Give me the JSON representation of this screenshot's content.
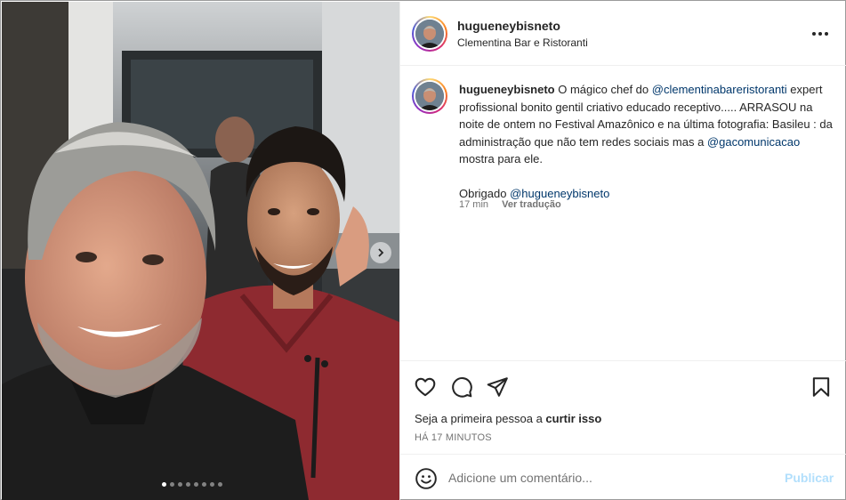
{
  "post": {
    "author": "hugueneybisneto",
    "location": "Clementina Bar e Ristoranti",
    "caption": {
      "username": "hugueneybisneto",
      "parts": [
        {
          "text": " O mágico chef do ",
          "type": "text"
        },
        {
          "text": "@clementinabareristoranti",
          "type": "mention"
        },
        {
          "text": " expert profissional bonito gentil criativo educado receptivo..... ARRASOU na noite de ontem no Festival Amazônico e na última fotografia: Basileu : da administração que não tem redes sociais mas a ",
          "type": "text"
        },
        {
          "text": "@gacomunicacao",
          "type": "mention"
        },
        {
          "text": " mostra para ele.",
          "type": "text"
        }
      ],
      "thanks_text": "Obrigado ",
      "thanks_mention": "@hugueneybisneto",
      "time": "17 min",
      "translate_label": "Ver tradução"
    },
    "likes": {
      "prefix": "Seja a primeira pessoa a ",
      "link": "curtir isso"
    },
    "time_ago": "HÁ 17 MINUTOS",
    "comment": {
      "placeholder": "Adicione um comentário...",
      "publish_label": "Publicar"
    },
    "carousel": {
      "total": 8,
      "active": 0
    }
  },
  "icons": {
    "more": "more-horizontal-icon",
    "like": "heart-icon",
    "comment": "comment-bubble-icon",
    "share": "paper-plane-icon",
    "save": "bookmark-icon",
    "emoji": "smiley-icon",
    "next": "chevron-right-icon"
  },
  "colors": {
    "mention": "#00376b",
    "publish_disabled": "#b2dffc",
    "shirt": "#8e2a30"
  }
}
